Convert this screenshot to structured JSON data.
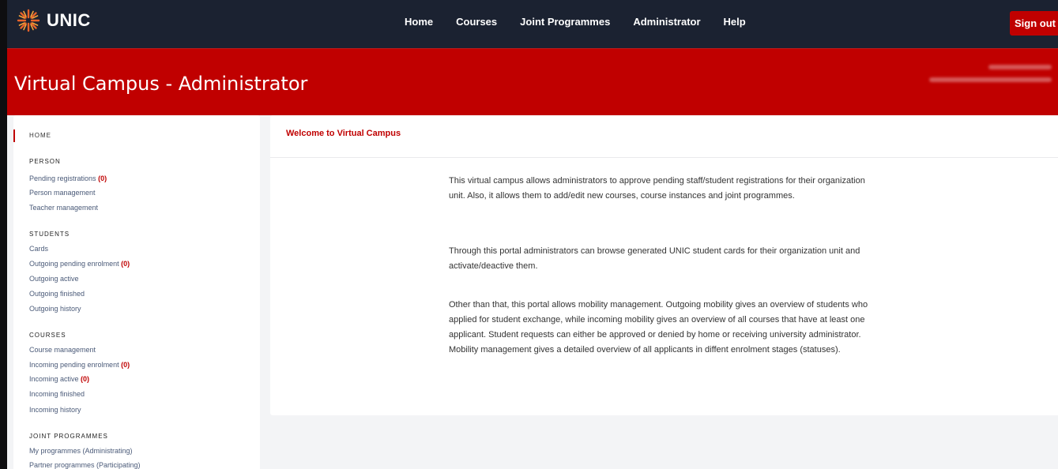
{
  "topnav": {
    "logo_text": "UNIC",
    "links": [
      "Home",
      "Courses",
      "Joint Programmes",
      "Administrator",
      "Help"
    ],
    "signout_label": "Sign out"
  },
  "banner": {
    "title": "Virtual Campus - Administrator"
  },
  "sidebar": {
    "home_label": "HOME",
    "sections": [
      {
        "title": "PERSON",
        "items": [
          {
            "label": "Pending registrations",
            "count": "(0)"
          },
          {
            "label": "Person management"
          },
          {
            "label": "Teacher management"
          }
        ]
      },
      {
        "title": "STUDENTS",
        "items": [
          {
            "label": "Cards"
          },
          {
            "label": "Outgoing pending enrolment",
            "count": "(0)"
          },
          {
            "label": "Outgoing active"
          },
          {
            "label": "Outgoing finished"
          },
          {
            "label": "Outgoing history"
          }
        ]
      },
      {
        "title": "COURSES",
        "items": [
          {
            "label": "Course management"
          },
          {
            "label": "Incoming pending enrolment",
            "count": "(0)"
          },
          {
            "label": "Incoming active",
            "count": "(0)"
          },
          {
            "label": "Incoming finished"
          },
          {
            "label": "Incoming history"
          }
        ]
      },
      {
        "title": "JOINT PROGRAMMES",
        "items": [
          {
            "label": "My programmes (Administrating)"
          },
          {
            "label": "Partner programmes (Participating)"
          }
        ]
      }
    ]
  },
  "main": {
    "card_title": "Welcome to Virtual Campus",
    "paragraphs": [
      "This virtual campus allows administrators to approve pending staff/student registrations for their organization unit. Also, it allows them to add/edit new courses, course instances and joint programmes.",
      "Through this portal administrators can browse generated UNIC student cards for their organization unit and activate/deactive them.",
      "Other than that, this portal allows mobility management. Outgoing mobility gives an overview of students who applied for student exchange, while incoming mobility gives an overview of all courses that have at least one applicant. Student requests can either be approved or denied by home or receiving university administrator. Mobility management gives a detailed overview of all applicants in diffent enrolment stages (statuses)."
    ]
  },
  "colors": {
    "nav_bg": "#1b2231",
    "accent_red": "#c00000",
    "link_text": "#4a5a78"
  },
  "icons": {
    "logo": "unic-sunburst-logo-icon"
  }
}
